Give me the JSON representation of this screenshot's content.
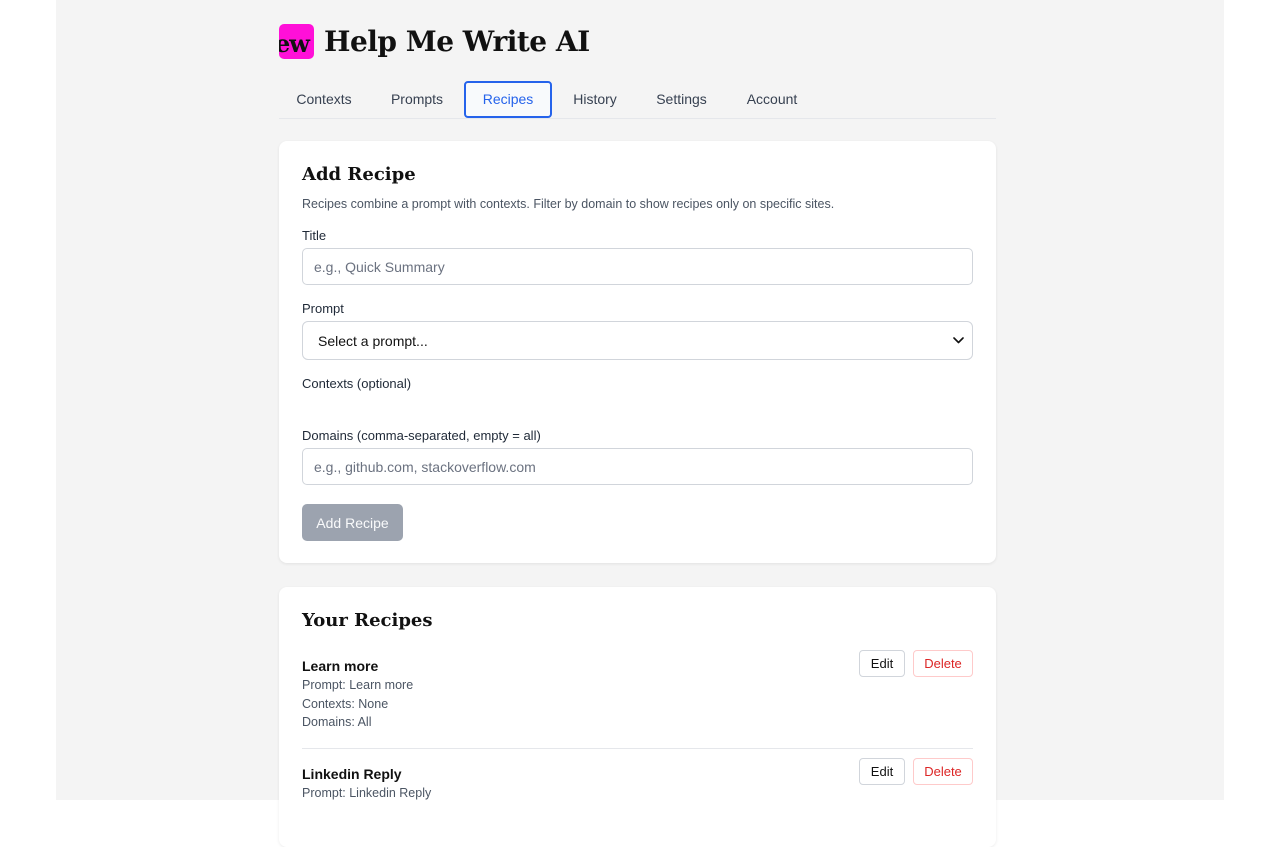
{
  "app": {
    "logo_text": "ew",
    "title": "Help Me Write AI"
  },
  "tabs": [
    {
      "label": "Contexts",
      "active": false
    },
    {
      "label": "Prompts",
      "active": false
    },
    {
      "label": "Recipes",
      "active": true
    },
    {
      "label": "History",
      "active": false
    },
    {
      "label": "Settings",
      "active": false
    },
    {
      "label": "Account",
      "active": false
    }
  ],
  "add_recipe": {
    "heading": "Add Recipe",
    "description": "Recipes combine a prompt with contexts. Filter by domain to show recipes only on specific sites.",
    "title_label": "Title",
    "title_placeholder": "e.g., Quick Summary",
    "title_value": "",
    "prompt_label": "Prompt",
    "prompt_selected": "Select a prompt...",
    "contexts_label": "Contexts (optional)",
    "domains_label": "Domains (comma-separated, empty = all)",
    "domains_placeholder": "e.g., github.com, stackoverflow.com",
    "domains_value": "",
    "submit_label": "Add Recipe"
  },
  "your_recipes": {
    "heading": "Your Recipes",
    "items": [
      {
        "title": "Learn more",
        "prompt": "Prompt: Learn more",
        "contexts": "Contexts: None",
        "domains": "Domains: All",
        "edit_label": "Edit",
        "delete_label": "Delete"
      },
      {
        "title": "Linkedin Reply",
        "prompt": "Prompt: Linkedin Reply",
        "contexts": "",
        "domains": "",
        "edit_label": "Edit",
        "delete_label": "Delete"
      }
    ]
  },
  "colors": {
    "accent": "#2563eb",
    "logo": "#ff10d8",
    "danger": "#dc2626",
    "disabled_button": "#9ca3af",
    "page_background": "#f4f4f4"
  },
  "icons": {
    "select_chevron": "chevron-down-icon"
  }
}
